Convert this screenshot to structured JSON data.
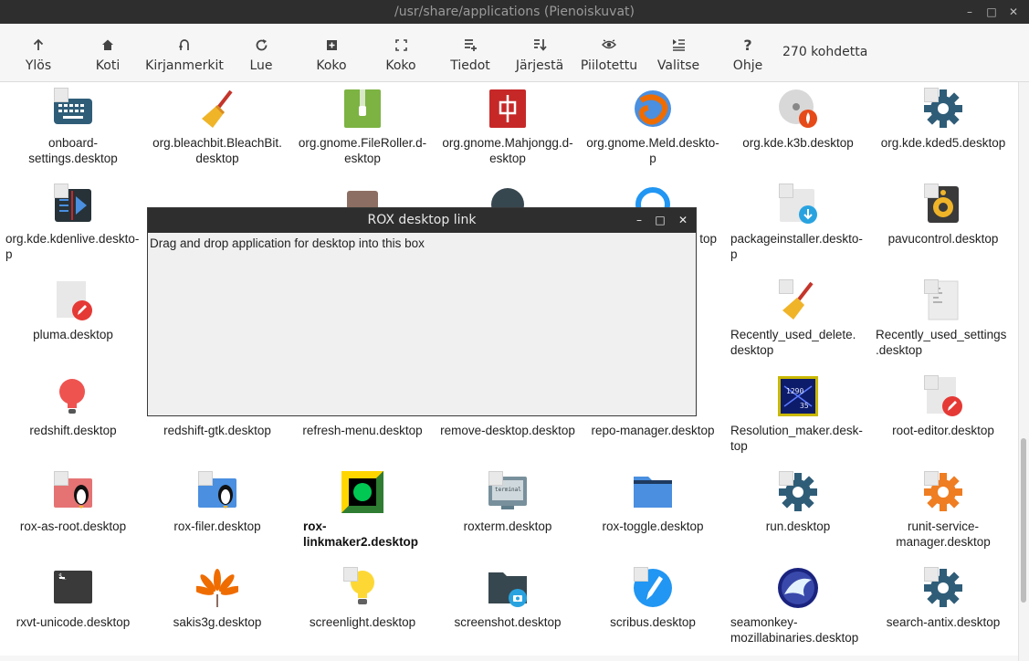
{
  "window": {
    "title": "/usr/share/applications (Pienoiskuvat)",
    "minimize_glyph": "–",
    "maximize_glyph": "□",
    "close_glyph": "✕"
  },
  "toolbar": {
    "up": "Ylös",
    "home": "Koti",
    "bookmarks": "Kirjanmerkit",
    "refresh": "Lue",
    "zoom_in": "Koko",
    "zoom_out": "Koko",
    "details": "Tiedot",
    "sort": "Järjestä",
    "hidden": "Piilotettu",
    "select": "Valitse",
    "help": "Ohje",
    "item_count": "270 kohdetta"
  },
  "files": [
    {
      "name": "onboard-settings.desktop",
      "line1": "onboard-",
      "line2": "settings.desktop",
      "icon": "keyboard-icon"
    },
    {
      "name": "org.bleachbit.BleachBit.desktop",
      "line1": "org.bleachbit.BleachBit.",
      "line2": "desktop",
      "icon": "broom-icon"
    },
    {
      "name": "org.gnome.FileRoller.desktop",
      "line1": "org.gnome.FileRoller.d-",
      "line2": "esktop",
      "icon": "archive-icon"
    },
    {
      "name": "org.gnome.Mahjongg.desktop",
      "line1": "org.gnome.Mahjongg.d-",
      "line2": "esktop",
      "icon": "mahjong-tile-icon"
    },
    {
      "name": "org.gnome.Meld.desktop",
      "line1": "org.gnome.Meld.deskto-",
      "line2": "p",
      "icon": "meld-icon"
    },
    {
      "name": "org.kde.k3b.desktop",
      "line1": "org.kde.k3b.desktop",
      "line2": "",
      "icon": "disc-burn-icon"
    },
    {
      "name": "org.kde.kded5.desktop",
      "line1": "org.kde.kded5.desktop",
      "line2": "",
      "icon": "gear-icon"
    },
    {
      "name": "org.kde.kdenlive.desktop",
      "line1": "org.kde.kdenlive.deskto-",
      "line2": "p",
      "icon": "video-editor-icon"
    },
    {
      "name": "",
      "line1": "",
      "line2": "",
      "icon": "wallet-icon"
    },
    {
      "name": "",
      "line1": "",
      "line2": "",
      "icon": "film-icon"
    },
    {
      "name": "",
      "line1": "",
      "line2": "",
      "icon": "ring-icon",
      "tail": "top"
    },
    {
      "name": "packageinstaller.desktop",
      "line1": "packageinstaller.deskto-",
      "line2": "p",
      "icon": "package-install-icon"
    },
    {
      "name": "pavucontrol.desktop",
      "line1": "pavucontrol.desktop",
      "line2": "",
      "icon": "speaker-icon"
    },
    {
      "name": "pluma.desktop",
      "line1": "pluma.desktop",
      "line2": "",
      "icon": "text-edit-icon"
    },
    {
      "name": "Recently_used_delete.desktop",
      "line1": "Recently_used_delete.",
      "line2": "desktop",
      "icon": "broom-icon"
    },
    {
      "name": "Recently_used_settings.desktop",
      "line1": "Recently_used_settings",
      "line2": ".desktop",
      "icon": "text-file-icon"
    },
    {
      "name": "redshift.desktop",
      "line1": "redshift.desktop",
      "line2": "",
      "icon": "bulb-red-icon"
    },
    {
      "name": "redshift-gtk.desktop",
      "line1": "redshift-gtk.desktop",
      "line2": "",
      "icon": ""
    },
    {
      "name": "refresh-menu.desktop",
      "line1": "refresh-menu.desktop",
      "line2": "",
      "icon": ""
    },
    {
      "name": "remove-desktop.desktop",
      "line1": "remove-desktop.desktop",
      "line2": "",
      "icon": ""
    },
    {
      "name": "repo-manager.desktop",
      "line1": "repo-manager.desktop",
      "line2": "",
      "icon": ""
    },
    {
      "name": "Resolution_maker.desktop",
      "line1": "Resolution_maker.desk-",
      "line2": "top",
      "icon": "resolution-icon"
    },
    {
      "name": "root-editor.desktop",
      "line1": "root-editor.desktop",
      "line2": "",
      "icon": "text-edit-icon"
    },
    {
      "name": "rox-as-root.desktop",
      "line1": "rox-as-root.desktop",
      "line2": "",
      "icon": "folder-root-icon"
    },
    {
      "name": "rox-filer.desktop",
      "line1": "rox-filer.desktop",
      "line2": "",
      "icon": "folder-penguin-icon"
    },
    {
      "name": "rox-linkmaker2.desktop",
      "line1": "rox-",
      "line2": "linkmaker2.desktop",
      "icon": "linkmaker-icon"
    },
    {
      "name": "roxterm.desktop",
      "line1": "roxterm.desktop",
      "line2": "",
      "icon": "terminal-screen-icon"
    },
    {
      "name": "rox-toggle.desktop",
      "line1": "rox-toggle.desktop",
      "line2": "",
      "icon": "folder-blue-icon"
    },
    {
      "name": "run.desktop",
      "line1": "run.desktop",
      "line2": "",
      "icon": "gear-icon"
    },
    {
      "name": "runit-service-manager.desktop",
      "line1": "runit-service-",
      "line2": "manager.desktop",
      "icon": "gear-orange-icon"
    },
    {
      "name": "rxvt-unicode.desktop",
      "line1": "rxvt-unicode.desktop",
      "line2": "",
      "icon": "terminal-icon"
    },
    {
      "name": "sakis3g.desktop",
      "line1": "sakis3g.desktop",
      "line2": "",
      "icon": "flower-icon"
    },
    {
      "name": "screenlight.desktop",
      "line1": "screenlight.desktop",
      "line2": "",
      "icon": "bulb-yellow-icon"
    },
    {
      "name": "screenshot.desktop",
      "line1": "screenshot.desktop",
      "line2": "",
      "icon": "camera-folder-icon"
    },
    {
      "name": "scribus.desktop",
      "line1": "scribus.desktop",
      "line2": "",
      "icon": "pen-icon"
    },
    {
      "name": "seamonkey-mozillabinaries.desktop",
      "line1": "seamonkey-",
      "line2": "mozillabinaries.desktop",
      "icon": "seamonkey-icon"
    },
    {
      "name": "search-antix.desktop",
      "line1": "search-antix.desktop",
      "line2": "",
      "icon": "gear-icon"
    }
  ],
  "dialog": {
    "title": "ROX desktop link",
    "instructions": "Drag and drop application for desktop into this box",
    "minimize_glyph": "–",
    "maximize_glyph": "□",
    "close_glyph": "✕"
  },
  "colors": {
    "titlebar": "#2e2e2e",
    "toolbar": "#f6f6f6",
    "gear_blue": "#2f5d78",
    "folder_blue": "#4a8fe0"
  }
}
